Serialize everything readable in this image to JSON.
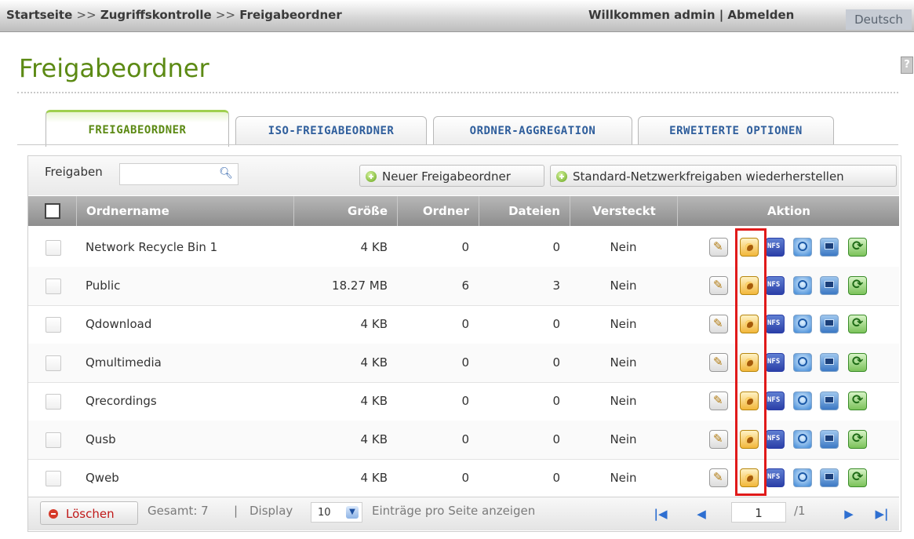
{
  "breadcrumb": {
    "home": "Startseite",
    "sep1": ">>",
    "access": "Zugriffskontrolle",
    "sep2": ">>",
    "current": "Freigabeordner"
  },
  "welcome": "Willkommen admin | Abmelden",
  "language": "Deutsch",
  "page_title": "Freigabeordner",
  "tabs": [
    {
      "label": "FREIGABEORDNER",
      "active": true
    },
    {
      "label": "ISO-FREIGABEORDNER",
      "active": false
    },
    {
      "label": "ORDNER-AGGREGATION",
      "active": false
    },
    {
      "label": "ERWEITERTE OPTIONEN",
      "active": false
    }
  ],
  "toolbar": {
    "filter_label": "Freigaben",
    "search_value": "",
    "new_folder_label": "Neuer Freigabeordner",
    "restore_label": "Standard-Netzwerkfreigaben wiederherstellen"
  },
  "table": {
    "headers": {
      "name": "Ordnername",
      "size": "Größe",
      "folders": "Ordner",
      "files": "Dateien",
      "hidden": "Versteckt",
      "action": "Aktion"
    },
    "rows": [
      {
        "name": "Network Recycle Bin 1",
        "size": "4 KB",
        "folders": "0",
        "files": "0",
        "hidden": "Nein"
      },
      {
        "name": "Public",
        "size": "18.27 MB",
        "folders": "6",
        "files": "3",
        "hidden": "Nein"
      },
      {
        "name": "Qdownload",
        "size": "4 KB",
        "folders": "0",
        "files": "0",
        "hidden": "Nein"
      },
      {
        "name": "Qmultimedia",
        "size": "4 KB",
        "folders": "0",
        "files": "0",
        "hidden": "Nein"
      },
      {
        "name": "Qrecordings",
        "size": "4 KB",
        "folders": "0",
        "files": "0",
        "hidden": "Nein"
      },
      {
        "name": "Qusb",
        "size": "4 KB",
        "folders": "0",
        "files": "0",
        "hidden": "Nein"
      },
      {
        "name": "Qweb",
        "size": "4 KB",
        "folders": "0",
        "files": "0",
        "hidden": "Nein"
      }
    ],
    "action_icons": [
      "edit-icon",
      "permission-icon",
      "nfs-icon",
      "web-icon",
      "monitor-icon",
      "refresh-icon"
    ]
  },
  "footer": {
    "delete_label": "Löschen",
    "total": "Gesamt: 7",
    "bar": "|",
    "display_label": "Display",
    "page_size": "10",
    "entries_label": "Einträge pro Seite anzeigen",
    "page_value": "1",
    "page_total": "/1"
  },
  "colors": {
    "title_green": "#5c8a14",
    "tab_blue": "#2f5e9c",
    "header_gray": "#a3a3a3",
    "highlight_red": "#e01a1a"
  }
}
